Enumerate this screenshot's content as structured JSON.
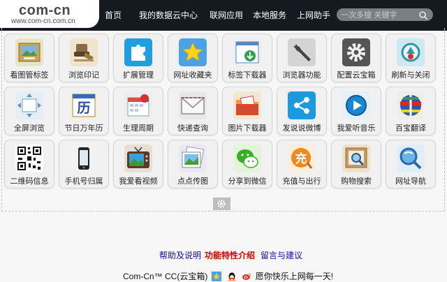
{
  "logo": {
    "title": "com-cn",
    "url": "www.com-cn.com.cn"
  },
  "nav": [
    "首页",
    "我的数据云中心",
    "联网应用",
    "本地服务",
    "上网助手"
  ],
  "search": {
    "placeholder": "一次多搜 关键字"
  },
  "tiles": [
    {
      "label": "看图管标签",
      "icon": "photo-frame-icon"
    },
    {
      "label": "浏览印记",
      "icon": "stamp-icon"
    },
    {
      "label": "扩展管理",
      "icon": "puzzle-icon"
    },
    {
      "label": "网址收藏夹",
      "icon": "star-icon"
    },
    {
      "label": "标签下载器",
      "icon": "download-window-icon"
    },
    {
      "label": "浏览器功能",
      "icon": "wrench-icon"
    },
    {
      "label": "配置云宝箱",
      "icon": "gear-icon"
    },
    {
      "label": "刷新与关闭",
      "icon": "recycle-icon"
    },
    {
      "label": "全屏浏览",
      "icon": "fullscreen-icon"
    },
    {
      "label": "节日万年历",
      "icon": "calendar-icon",
      "glyph": "历"
    },
    {
      "label": "生理周期",
      "icon": "cycle-calendar-icon"
    },
    {
      "label": "快递查询",
      "icon": "envelope-icon"
    },
    {
      "label": "图片下载器",
      "icon": "folder-icon"
    },
    {
      "label": "发说说微博",
      "icon": "share-icon"
    },
    {
      "label": "我爱听音乐",
      "icon": "music-icon"
    },
    {
      "label": "百宝翻译",
      "icon": "globe-flags-icon"
    },
    {
      "label": "二维码信息",
      "icon": "qr-code-icon"
    },
    {
      "label": "手机号归属",
      "icon": "mobile-phone-icon"
    },
    {
      "label": "我爱看视频",
      "icon": "tv-icon"
    },
    {
      "label": "点点传图",
      "icon": "photos-icon"
    },
    {
      "label": "分享到微信",
      "icon": "wechat-icon"
    },
    {
      "label": "充值与出行",
      "icon": "recharge-icon",
      "glyph": "充"
    },
    {
      "label": "购物搜索",
      "icon": "shopping-search-icon"
    },
    {
      "label": "网址导航",
      "icon": "navigation-icon"
    }
  ],
  "footer": {
    "links": [
      "帮助及说明",
      "功能特性介绍",
      "留言与建议"
    ],
    "prefix": "Com-Cn™ CC(云宝箱)",
    "slogan": "愿你快乐上网每一天!"
  },
  "colors": {
    "header_bg": "#151a20",
    "link": "#1010a0",
    "link_highlight": "#d40000"
  }
}
